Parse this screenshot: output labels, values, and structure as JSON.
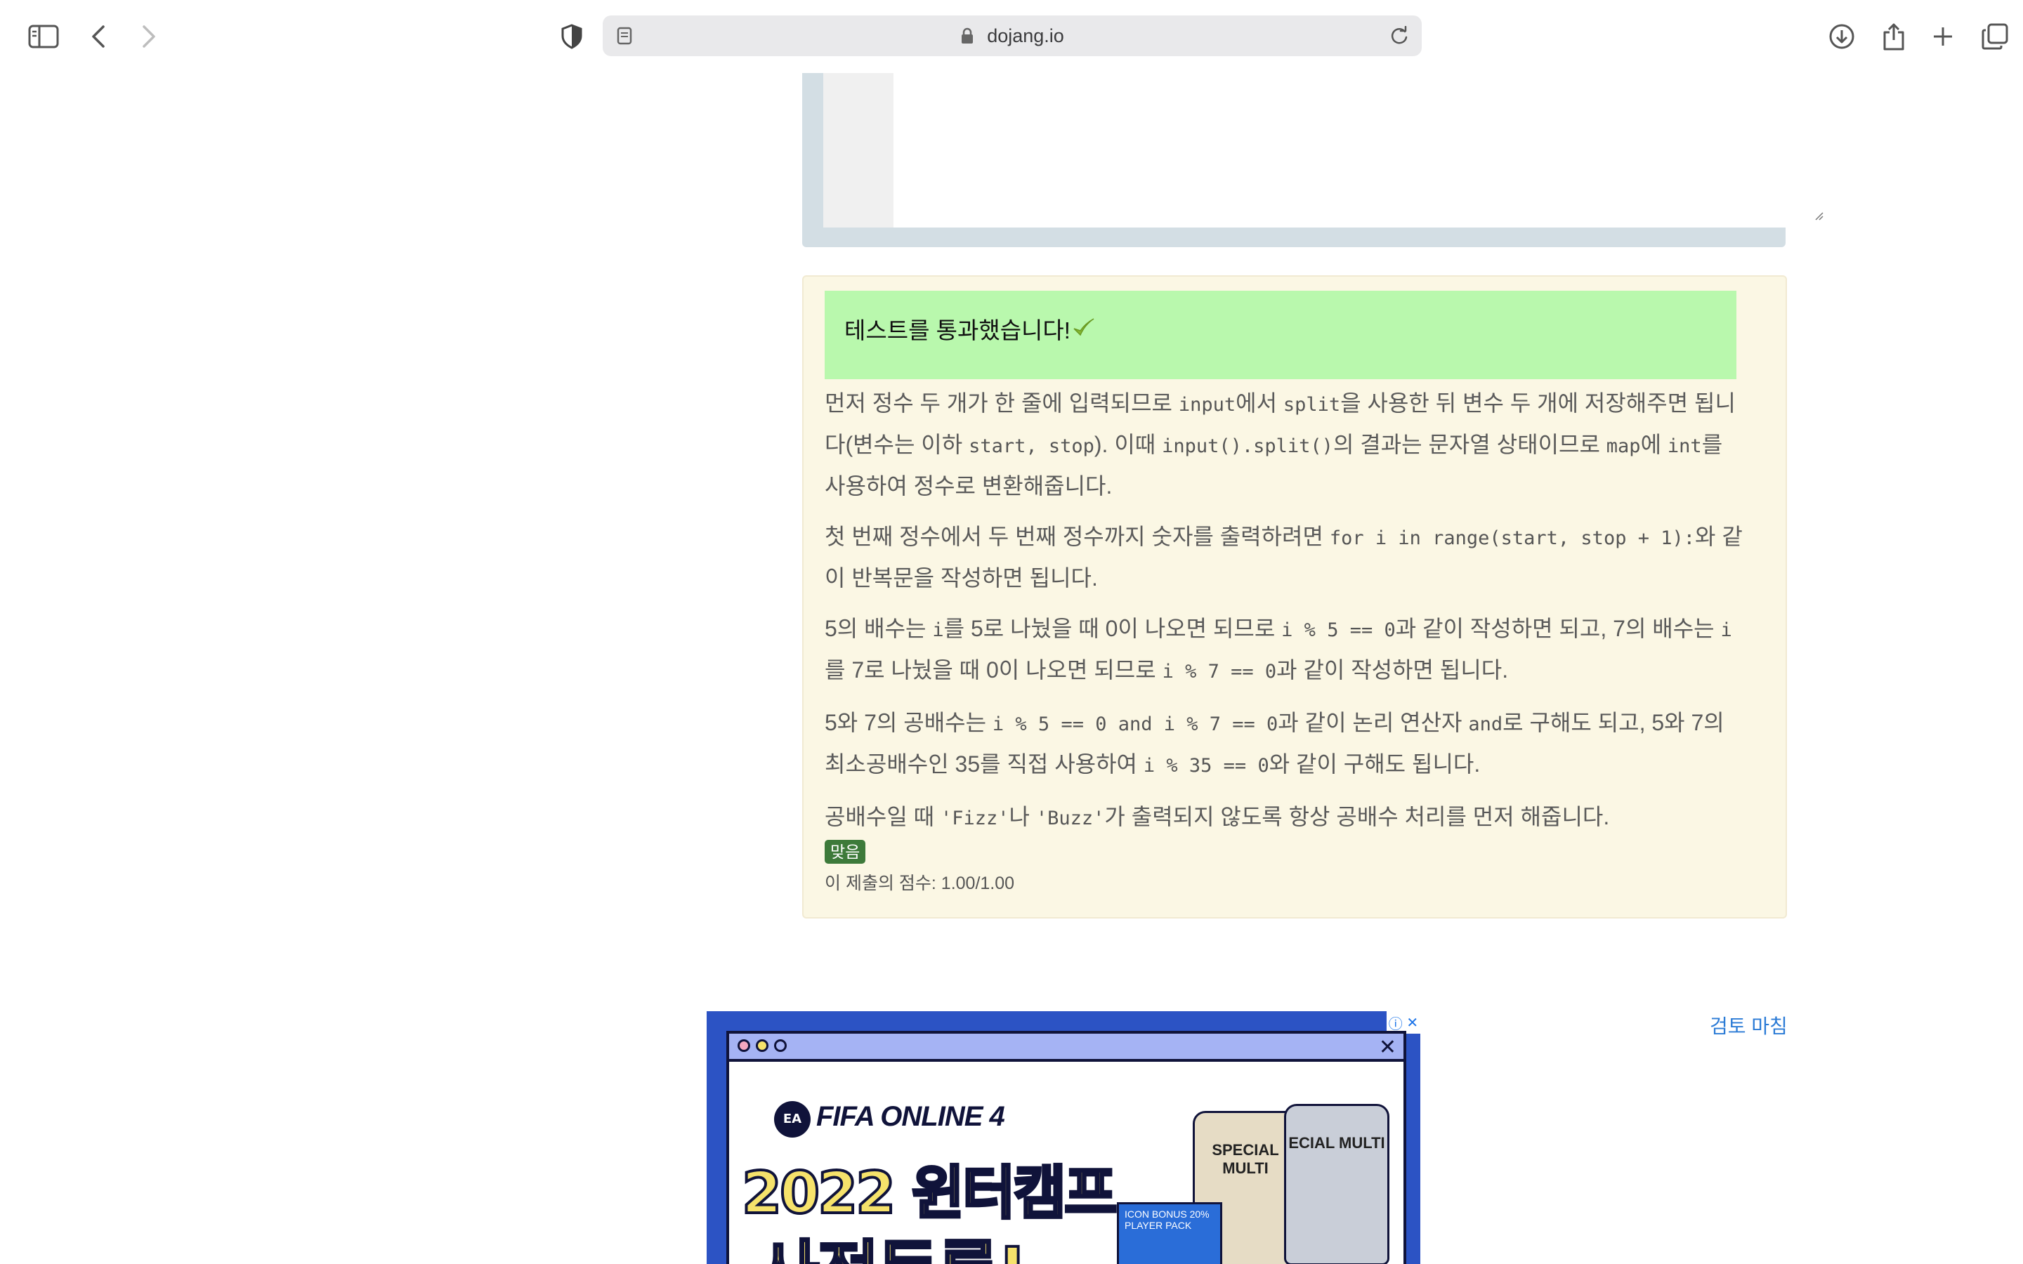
{
  "browser": {
    "url": "dojang.io",
    "icons": [
      "sidebar-icon",
      "back-icon",
      "forward-icon",
      "privacy-shield-icon",
      "reader-icon",
      "lock-icon",
      "reload-icon",
      "download-icon",
      "share-icon",
      "new-tab-icon",
      "tab-overview-icon"
    ]
  },
  "result": {
    "success_message": "테스트를 통과했습니다!",
    "badge": "맞음",
    "score": "이 제출의 점수: 1.00/1.00",
    "colors": {
      "banner": "#b9f8ad",
      "panel": "#fbf7e4",
      "badge": "#3d7a3a"
    },
    "p1": {
      "t1": "먼저 정수 두 개가 한 줄에 입력되므로 ",
      "c1": "input",
      "t2": "에서 ",
      "c2": "split",
      "t3": "을 사용한 뒤 변수 두 개에 저장해주면 됩니다(변수는 이하 ",
      "c3": "start, stop",
      "t4": "). 이때 ",
      "c4": "input().split()",
      "t5": "의 결과는 문자열 상태이므로 ",
      "c5": "map",
      "t6": "에 ",
      "c6": "int",
      "t7": "를 사용하여 정수로 변환해줍니다."
    },
    "p2": {
      "t1": "첫 번째 정수에서 두 번째 정수까지 숫자를 출력하려면 ",
      "c1": "for i in range(start, stop + 1):",
      "t2": "와 같이 반복문을 작성하면 됩니다."
    },
    "p3": {
      "t1": "5의 배수는 ",
      "c1": "i",
      "t2": "를 5로 나눴을 때 0이 나오면 되므로 ",
      "c2": "i % 5 == 0",
      "t3": "과 같이 작성하면 되고, 7의 배수는 ",
      "c3": "i",
      "t4": "를 7로 나눴을 때 0이 나오면 되므로 ",
      "c4": "i % 7 == 0",
      "t5": "과 같이 작성하면 됩니다."
    },
    "p4": {
      "t1": "5와 7의 공배수는 ",
      "c1": "i % 5 == 0 and i % 7 == 0",
      "t2": "과 같이 논리 연산자 ",
      "c2": "and",
      "t3": "로 구해도 되고, 5와 7의 최소공배수인 35를 직접 사용하여 ",
      "c3": "i % 35 == 0",
      "t4": "와 같이 구해도 됩니다."
    },
    "p5": {
      "t1": "공배수일 때 ",
      "c1": "'Fizz'",
      "t2": "나 ",
      "c2": "'Buzz'",
      "t3": "가 출력되지 않도록 항상 공배수 처리를 먼저 해줍니다."
    }
  },
  "ad": {
    "brand": "FIFA ONLINE 4",
    "ea_logo": "EA",
    "headline1": "2022 윈터캠프",
    "headline2": "사전등록!",
    "card1": "SPECIAL MULTI",
    "card2": "ECIAL MULTI",
    "pack": "ICON BONUS 20% PLAYER PACK",
    "info_icon": "ⓘ",
    "close_icon": "✕"
  },
  "review_done": "검토 마침"
}
